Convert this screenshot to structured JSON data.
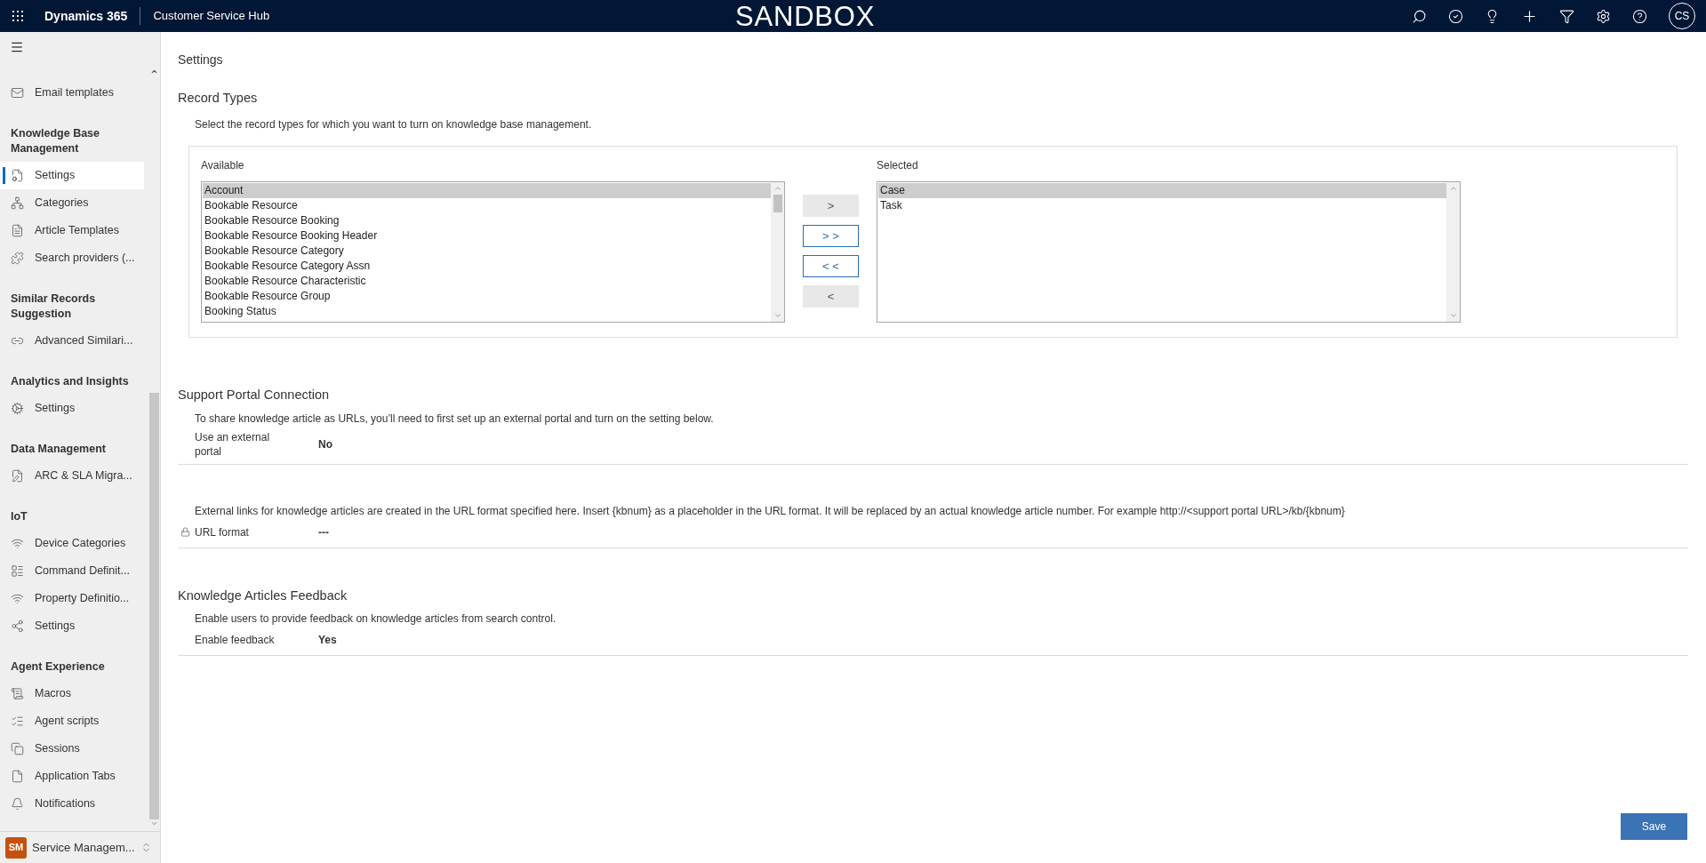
{
  "header": {
    "app_name": "Dynamics 365",
    "module": "Customer Service Hub",
    "environment": "SANDBOX",
    "avatar_initials": "CS"
  },
  "sidebar": {
    "groups": [
      {
        "items": [
          {
            "label": "Email templates",
            "selected": false
          }
        ]
      },
      {
        "title": "Knowledge Base Management",
        "items": [
          {
            "label": "Settings",
            "selected": true
          },
          {
            "label": "Categories",
            "selected": false
          },
          {
            "label": "Article Templates",
            "selected": false
          },
          {
            "label": "Search providers (...",
            "selected": false
          }
        ]
      },
      {
        "title": "Similar Records Suggestion",
        "items": [
          {
            "label": "Advanced Similari...",
            "selected": false
          }
        ]
      },
      {
        "title": "Analytics and Insights",
        "items": [
          {
            "label": "Settings",
            "selected": false
          }
        ]
      },
      {
        "title": "Data Management",
        "items": [
          {
            "label": "ARC & SLA Migra...",
            "selected": false
          }
        ]
      },
      {
        "title": "IoT",
        "items": [
          {
            "label": "Device Categories",
            "selected": false
          },
          {
            "label": "Command Definit...",
            "selected": false
          },
          {
            "label": "Property Definitio...",
            "selected": false
          },
          {
            "label": "Settings",
            "selected": false
          }
        ]
      },
      {
        "title": "Agent Experience",
        "items": [
          {
            "label": "Macros",
            "selected": false
          },
          {
            "label": "Agent scripts",
            "selected": false
          },
          {
            "label": "Sessions",
            "selected": false
          },
          {
            "label": "Application Tabs",
            "selected": false
          },
          {
            "label": "Notifications",
            "selected": false
          }
        ]
      }
    ],
    "area": {
      "badge": "SM",
      "label": "Service Managem..."
    }
  },
  "page": {
    "title": "Settings",
    "record_types": {
      "title": "Record Types",
      "description": "Select the record types for which you want to turn on knowledge base management.",
      "available": {
        "label": "Available",
        "items": [
          {
            "label": "Account",
            "selected": true
          },
          {
            "label": "Bookable Resource",
            "selected": false
          },
          {
            "label": "Bookable Resource Booking",
            "selected": false
          },
          {
            "label": "Bookable Resource Booking Header",
            "selected": false
          },
          {
            "label": "Bookable Resource Category",
            "selected": false
          },
          {
            "label": "Bookable Resource Category Assn",
            "selected": false
          },
          {
            "label": "Bookable Resource Characteristic",
            "selected": false
          },
          {
            "label": "Bookable Resource Group",
            "selected": false
          },
          {
            "label": "Booking Status",
            "selected": false
          }
        ]
      },
      "buttons": [
        {
          "label": ">",
          "disabled": true
        },
        {
          "label": "> >",
          "disabled": false
        },
        {
          "label": "< <",
          "disabled": false
        },
        {
          "label": "<",
          "disabled": true
        }
      ],
      "selected": {
        "label": "Selected",
        "items": [
          {
            "label": "Case",
            "selected": true
          },
          {
            "label": "Task",
            "selected": false
          }
        ]
      }
    },
    "sections": [
      {
        "title": "Support Portal Connection",
        "description": "To share knowledge article as URLs, you’ll need to first set up an external portal and turn on the setting below.",
        "field": {
          "label": "Use an external portal",
          "value": "No",
          "locked": false
        }
      },
      {
        "description": "External links for knowledge articles are created in the URL format specified here. Insert {kbnum} as a placeholder in the URL format. It will be replaced by an actual knowledge article number. For example http://<support portal URL>/kb/{kbnum}",
        "field": {
          "label": "URL format",
          "value": "---",
          "locked": true
        }
      },
      {
        "title": "Knowledge Articles Feedback",
        "description": "Enable users to provide feedback on knowledge articles from search control.",
        "field": {
          "label": "Enable feedback",
          "value": "Yes",
          "locked": false
        }
      }
    ],
    "save_button": "Save"
  }
}
